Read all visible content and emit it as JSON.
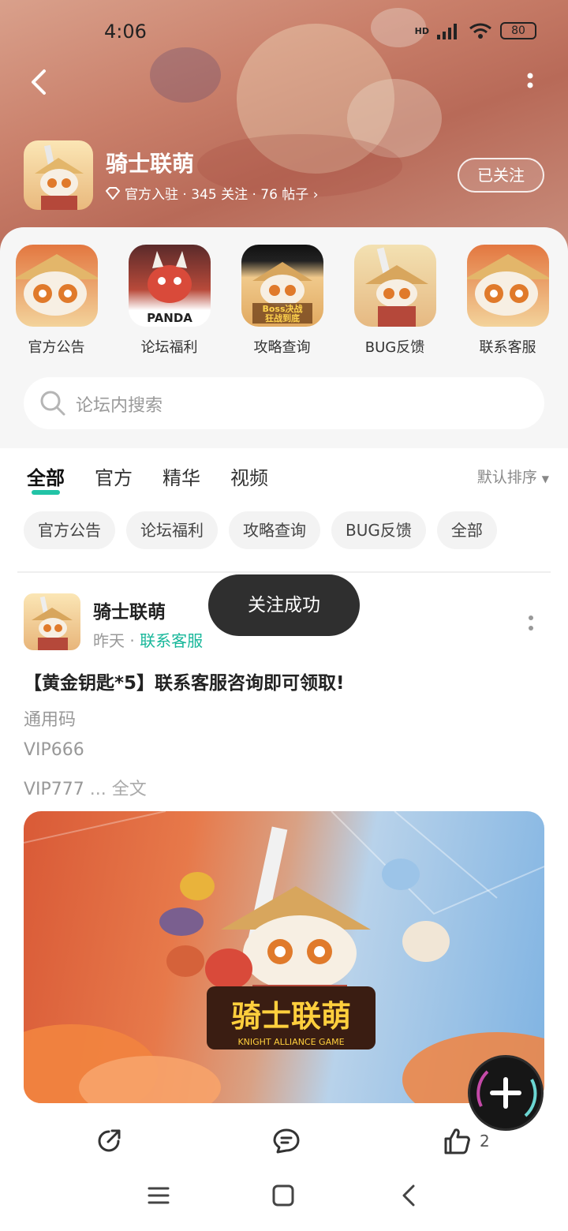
{
  "status_bar": {
    "time": "4:06",
    "network": "HD",
    "battery": "80"
  },
  "header": {
    "forum_name": "骑士联萌",
    "meta_text": "官方入驻 · 345 关注 · 76 帖子 ›",
    "follow_label": "已关注"
  },
  "shortcuts": [
    {
      "label": "官方公告"
    },
    {
      "label": "论坛福利",
      "thumb_text": "PANDA"
    },
    {
      "label": "攻略查询",
      "thumb_text": "Boss决战\n狂战到底"
    },
    {
      "label": "BUG反馈"
    },
    {
      "label": "联系客服"
    }
  ],
  "search": {
    "placeholder": "论坛内搜索"
  },
  "tabs": [
    {
      "label": "全部",
      "active": true
    },
    {
      "label": "官方"
    },
    {
      "label": "精华"
    },
    {
      "label": "视频"
    }
  ],
  "sort_label": "默认排序",
  "chips": [
    "官方公告",
    "论坛福利",
    "攻略查询",
    "BUG反馈",
    "全部"
  ],
  "toast": "关注成功",
  "post": {
    "author": "骑士联萌",
    "time": "昨天",
    "category": "联系客服",
    "title": "【黄金钥匙*5】联系客服咨询即可领取!",
    "lines": [
      "通用码",
      "VIP666",
      "VIP777"
    ],
    "more_text": "... 全文",
    "image_logo_text": "骑士联萌",
    "image_logo_sub": "KNIGHT ALLIANCE GAME",
    "like_count": "2"
  },
  "colors": {
    "accent": "#22c3a6",
    "tag": "#17b79a"
  }
}
